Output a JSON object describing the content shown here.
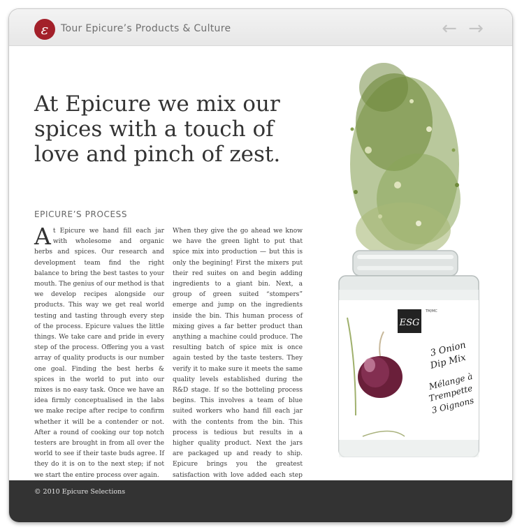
{
  "header": {
    "logo_glyph": "ε",
    "title": "Tour Epicure’s Products & Culture",
    "prev_arrow": "←",
    "next_arrow": "→"
  },
  "main": {
    "headline": "At Epicure we mix our spices with a touch of love and pinch of zest.",
    "section_heading": "EPICURE’S PROCESS",
    "column1": {
      "dropcap": "A",
      "text": "t Epicure we hand fill each jar with wholesome and organic herbs and spices. Our research and development team find the right balance to bring the best tastes to your mouth. The genius of our method is that we develop recipes alongside our products. This way we get real world testing and tasting through every step of the process. Epicure values the little things. We take care and pride in every step of the process. Offering you a vast array of quality products is our number one goal. Finding the best herbs & spices in the world to put into our mixes is no easy task. Once we have an idea firmly conceptualised in the labs we make recipe after recipe to confirm whether it will be a contender or not. After a round of cooking our top notch testers are brought in from all over the world to see if their taste buds agree. If they do it is on to the next step; if not we start the entire process over again."
    },
    "column2": {
      "text": "When they give the go ahead we know we have the green light to put that spice mix into production — but this is only the begining! First the mixers put their red suites on and begin adding ingredients to a giant bin. Next, a group of green suited “stompers” emerge and jump on the ingredients inside the bin. This human process of mixing gives a far better product than anything a machine could produce. The resulting batch of spice mix is once again tested by the taste testers. They verify it to make sure it meets the same quality levels established during the R&D stage. If so the botteling process begins. This involves a team of blue suited workers who hand fill each jar with the contents from the bin. This process is tedious but results in a higher quality product. Next the jars are packaged up and ready to ship. Epicure brings you the greatest satisfaction with love added each step of the way.",
      "ornament": "❧"
    },
    "product_label": {
      "monogram": "ESG",
      "mark": "TM/MC",
      "lines": [
        "3 Onion",
        "Dip Mix",
        "Mélange à",
        "Trempette",
        "3 Oignons"
      ]
    }
  },
  "footer": {
    "copyright": "© 2010 Epicure Selections"
  },
  "colors": {
    "brand_red": "#a3202a",
    "footer_bg": "#333333",
    "header_bg": "#ebebeb",
    "herb_green": "#6f8a3a"
  }
}
